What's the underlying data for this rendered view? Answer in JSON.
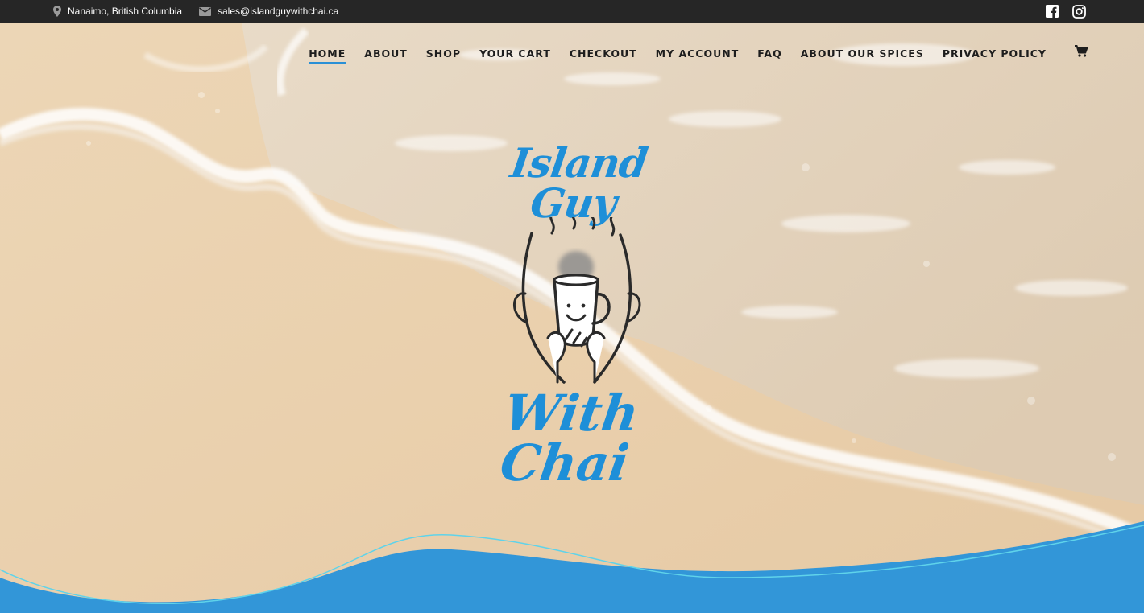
{
  "topbar": {
    "location": "Nanaimo, British Columbia",
    "email": "sales@islandguywithchai.ca",
    "location_icon": "map-pin-icon",
    "email_icon": "envelope-icon",
    "social": [
      "facebook-icon",
      "instagram-icon"
    ]
  },
  "nav": {
    "items": [
      "HOME",
      "ABOUT",
      "SHOP",
      "YOUR CART",
      "CHECKOUT",
      "MY ACCOUNT",
      "FAQ",
      "ABOUT OUR SPICES",
      "PRIVACY POLICY"
    ],
    "active": "HOME",
    "cart_icon": "shopping-cart-icon"
  },
  "logo": {
    "line1": "Island Guy",
    "line2": "With Chai",
    "illustration": "guy-holding-chai-cup"
  },
  "colors": {
    "topbar": "#262626",
    "accent": "#1e8fd8",
    "wave": "#3296d8",
    "sand": "#e9d3b3"
  }
}
